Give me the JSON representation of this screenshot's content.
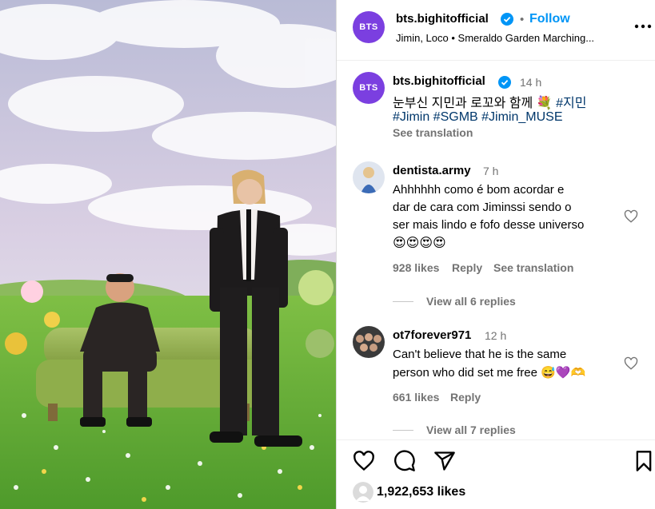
{
  "post": {
    "author": "bts.bighitofficial",
    "avatar_text": "BTS",
    "follow_label": "Follow",
    "separator": "•",
    "location": "Jimin, Loco • Smeraldo Garden Marching...",
    "more_icon": "more-horizontal-icon",
    "caption": {
      "time": "14 h",
      "line1": "눈부신 지민과 로꼬와 함께 💐",
      "line1_tag": "#지민",
      "line2_tags": "#Jimin #SGMB #Jimin_MUSE",
      "see_translation": "See translation"
    }
  },
  "comments": [
    {
      "username": "dentista.army",
      "time": "7 h",
      "lines": [
        "Ahhhhhh como é bom acordar e",
        "dar de cara com Jiminssi sendo o",
        "ser mais lindo e fofo desse universo",
        "😍😍😍😍"
      ],
      "likes": "928 likes",
      "reply": "Reply",
      "see_translation": "See translation",
      "view_replies": "View all 6 replies"
    },
    {
      "username": "ot7forever971",
      "time": "12 h",
      "lines": [
        "Can't believe that he is the same",
        "person who did set me free 😅💜🫶"
      ],
      "likes": "661 likes",
      "reply": "Reply",
      "view_replies": "View all 7 replies"
    }
  ],
  "actions": {
    "icons": [
      "heart-icon",
      "comment-icon",
      "share-icon",
      "bookmark-icon"
    ],
    "likes_count": "1,922,653 likes"
  },
  "colors": {
    "accent": "#0095f6",
    "brand_avatar": "#7b3fe0",
    "hashtag": "#00376b",
    "muted": "#737373"
  }
}
